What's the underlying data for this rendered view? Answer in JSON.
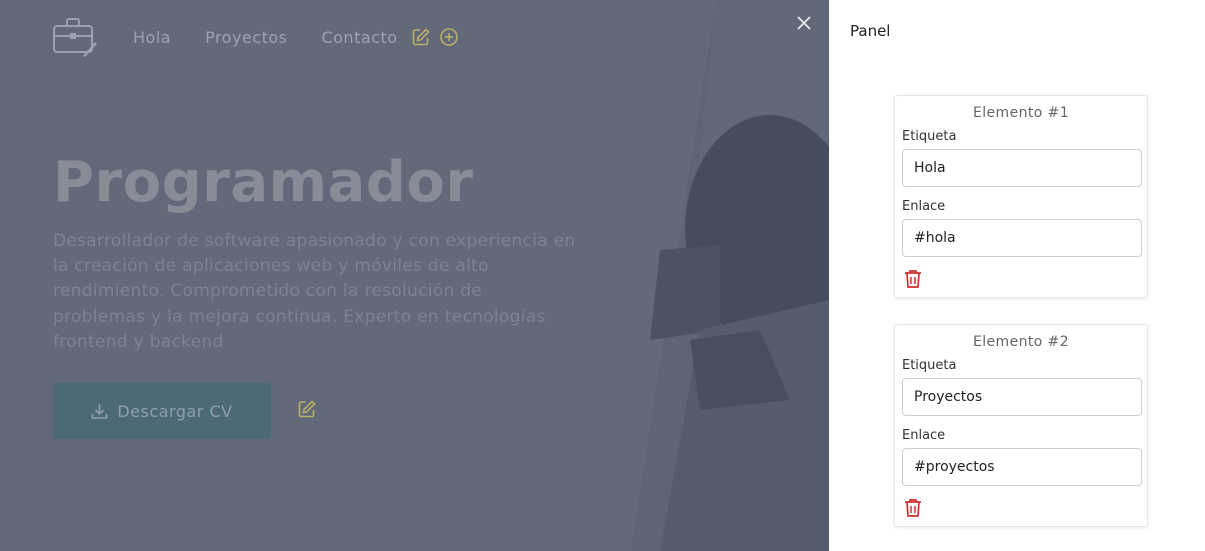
{
  "nav": {
    "items": [
      {
        "label": "Hola"
      },
      {
        "label": "Proyectos"
      },
      {
        "label": "Contacto"
      }
    ]
  },
  "hero": {
    "title": "Programador",
    "description": "Desarrollador de software apasionado y con experiencia en la creación de aplicaciones web y móviles de alto rendimiento. Comprometido con la resolución de problemas y la mejora continua. Experto en tecnologías frontend y backend",
    "cv_button": "Descargar CV"
  },
  "panel": {
    "title": "Panel",
    "label_text": "Etiqueta",
    "link_text": "Enlace",
    "elements": [
      {
        "title": "Elemento #1",
        "label_value": "Hola",
        "link_value": "#hola"
      },
      {
        "title": "Elemento #2",
        "label_value": "Proyectos",
        "link_value": "#proyectos"
      }
    ]
  },
  "colors": {
    "overlay": "#4b5263",
    "accent": "#b8ae6a",
    "cv_button": "#4c6976",
    "danger": "#d32f2f"
  }
}
